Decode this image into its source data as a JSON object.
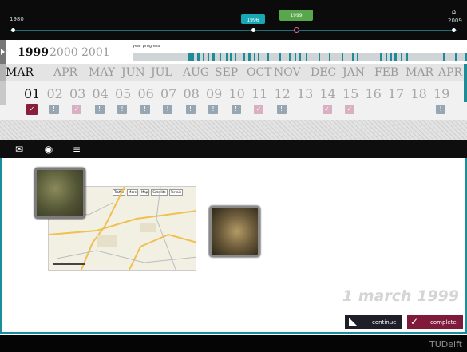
{
  "timeline": {
    "start_label": "1980",
    "end_label": "2009",
    "marker_1996": "1996",
    "marker_1999": "1999",
    "home_icon": "home-icon"
  },
  "years": {
    "selected": "1999",
    "others": [
      "2000",
      "2001"
    ],
    "progress_label": "year progress"
  },
  "months": [
    "MAR",
    "APR",
    "MAY",
    "JUN",
    "JUL",
    "AUG",
    "SEP",
    "OCT",
    "NOV",
    "DEC",
    "JAN",
    "FEB",
    "MAR",
    "APR"
  ],
  "days": [
    "01",
    "02",
    "03",
    "04",
    "05",
    "06",
    "07",
    "08",
    "09",
    "10",
    "11",
    "12",
    "13",
    "14",
    "15",
    "16",
    "17",
    "18",
    "19"
  ],
  "day_markers": [
    {
      "day": "01",
      "state": "selected",
      "glyph": "✓"
    },
    {
      "day": "02",
      "state": "blue",
      "glyph": "!"
    },
    {
      "day": "03",
      "state": "pink",
      "glyph": "✓"
    },
    {
      "day": "04",
      "state": "blue",
      "glyph": "!"
    },
    {
      "day": "05",
      "state": "blue",
      "glyph": "!"
    },
    {
      "day": "06",
      "state": "blue",
      "glyph": "!"
    },
    {
      "day": "07",
      "state": "blue",
      "glyph": "!"
    },
    {
      "day": "08",
      "state": "blue",
      "glyph": "!"
    },
    {
      "day": "09",
      "state": "blue",
      "glyph": "!"
    },
    {
      "day": "10",
      "state": "blue",
      "glyph": "!"
    },
    {
      "day": "11",
      "state": "pink",
      "glyph": "✓"
    },
    {
      "day": "12",
      "state": "blue",
      "glyph": "!"
    },
    {
      "day": "14",
      "state": "pink",
      "glyph": "✓"
    },
    {
      "day": "15",
      "state": "pink",
      "glyph": "✓"
    },
    {
      "day": "19",
      "state": "blue",
      "glyph": "!"
    }
  ],
  "toolbar": {
    "icons": [
      "add-note-icon",
      "add-globe-icon",
      "add-list-icon"
    ]
  },
  "canvas": {
    "date": "1 march 1999"
  },
  "map_tabs": [
    "Traffic",
    "More",
    "Map",
    "Satellite",
    "Terrain"
  ],
  "actions": {
    "continue": "continue",
    "complete": "complete"
  },
  "footer": {
    "logo_text": "TUDelft"
  },
  "colors": {
    "accent": "#1f8b96",
    "pill_1996": "#19a7b6",
    "pill_1999": "#5aa64c",
    "selected_day": "#8a1c3c",
    "complete": "#7f1a3b"
  }
}
